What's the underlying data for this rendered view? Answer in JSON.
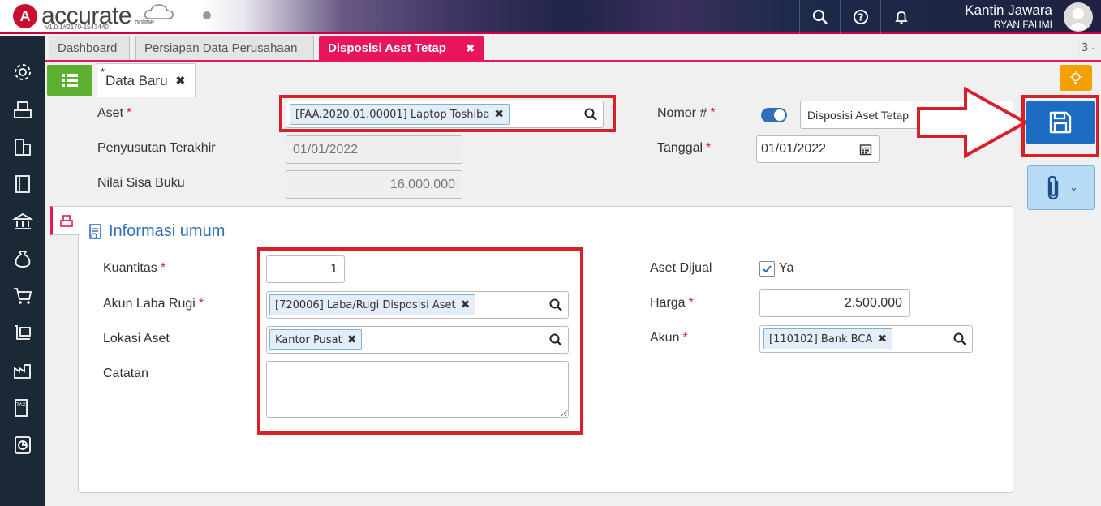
{
  "app": {
    "brand": "accurate",
    "brand_sub": "online",
    "version": "v1.0.1#2170-1543440",
    "user_name": "Kantin Jawara",
    "user_sub": "RYAN FAHMI"
  },
  "tabs": [
    {
      "label": "Dashboard"
    },
    {
      "label": "Persiapan Data Perusahaan"
    },
    {
      "label": "Disposisi Aset Tetap",
      "close": "✖"
    }
  ],
  "tabs_count": "3",
  "subtab": {
    "star": "*",
    "label": "Data Baru",
    "close": "✖"
  },
  "form": {
    "aset_label": "Aset",
    "aset_value": "[FAA.2020.01.00001] Laptop Toshiba",
    "penyusutan_label": "Penyusutan Terakhir",
    "penyusutan_value": "01/01/2022",
    "nilai_label": "Nilai Sisa Buku",
    "nilai_value": "16.000.000",
    "nomor_label": "Nomor #",
    "nomor_value": "Disposisi Aset Tetap",
    "tanggal_label": "Tanggal",
    "tanggal_value": "01/01/2022",
    "required_mark": "*"
  },
  "section": {
    "title": "Informasi umum",
    "kuantitas_label": "Kuantitas",
    "kuantitas_value": "1",
    "akun_lr_label": "Akun Laba Rugi",
    "akun_lr_value": "[720006] Laba/Rugi Disposisi Aset",
    "lokasi_label": "Lokasi Aset",
    "lokasi_value": "Kantor Pusat",
    "catatan_label": "Catatan",
    "aset_dijual_label": "Aset Dijual",
    "aset_dijual_value": "Ya",
    "harga_label": "Harga",
    "harga_value": "2.500.000",
    "akun_label": "Akun",
    "akun_value": "[110102] Bank BCA"
  },
  "colors": {
    "accent": "#e8155d",
    "primary": "#1c6cc4",
    "highlight": "#d8202a",
    "success": "#5cb030",
    "sidebar": "#1b2836"
  },
  "icons": [
    "search-icon",
    "help-icon",
    "bell-icon",
    "gear-icon",
    "save-icon",
    "paperclip-icon",
    "calendar-icon",
    "bulb-icon",
    "list-icon"
  ]
}
